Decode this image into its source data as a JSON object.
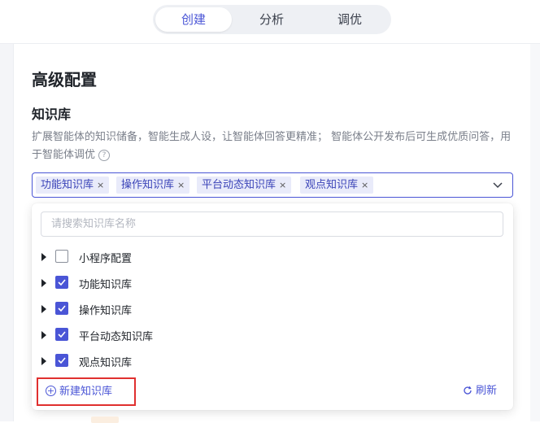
{
  "tabs": [
    {
      "label": "创建",
      "active": true
    },
    {
      "label": "分析",
      "active": false
    },
    {
      "label": "调优",
      "active": false
    }
  ],
  "section": {
    "title": "高级配置",
    "subtitle": "知识库",
    "description": "扩展智能体的知识储备，智能生成人设，让智能体回答更精准； 智能体公开发布后可生成优质问答，用于智能体调优"
  },
  "select": {
    "tags": [
      "功能知识库",
      "操作知识库",
      "平台动态知识库",
      "观点知识库"
    ],
    "remove_glyph": "×"
  },
  "dropdown": {
    "search_placeholder": "请搜索知识库名称",
    "items": [
      {
        "label": "小程序配置",
        "checked": false
      },
      {
        "label": "功能知识库",
        "checked": true
      },
      {
        "label": "操作知识库",
        "checked": true
      },
      {
        "label": "平台动态知识库",
        "checked": true
      },
      {
        "label": "观点知识库",
        "checked": true
      }
    ],
    "new_label": "新建知识库",
    "refresh_label": "刷新"
  },
  "colors": {
    "accent": "#4a55d6",
    "highlight_border": "#e0302f",
    "tag_bg": "#e9ebfa"
  }
}
